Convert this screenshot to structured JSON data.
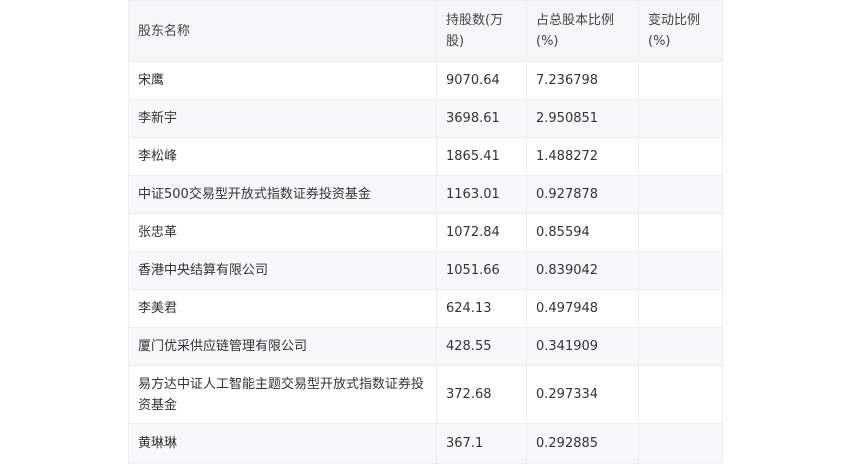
{
  "table": {
    "headers": [
      "股东名称",
      "持股数(万股)",
      "占总股本比例(%)",
      "变动比例(%)"
    ],
    "rows": [
      {
        "name": "宋鹰",
        "shares": "9070.64",
        "ratio": "7.236798",
        "change": ""
      },
      {
        "name": "李新宇",
        "shares": "3698.61",
        "ratio": "2.950851",
        "change": ""
      },
      {
        "name": "李松峰",
        "shares": "1865.41",
        "ratio": "1.488272",
        "change": ""
      },
      {
        "name": "中证500交易型开放式指数证券投资基金",
        "shares": "1163.01",
        "ratio": "0.927878",
        "change": ""
      },
      {
        "name": "张忠革",
        "shares": "1072.84",
        "ratio": "0.85594",
        "change": ""
      },
      {
        "name": "香港中央结算有限公司",
        "shares": "1051.66",
        "ratio": "0.839042",
        "change": ""
      },
      {
        "name": "李美君",
        "shares": "624.13",
        "ratio": "0.497948",
        "change": ""
      },
      {
        "name": "厦门优采供应链管理有限公司",
        "shares": "428.55",
        "ratio": "0.341909",
        "change": ""
      },
      {
        "name": "易方达中证人工智能主题交易型开放式指数证券投资基金",
        "shares": "372.68",
        "ratio": "0.297334",
        "change": ""
      },
      {
        "name": "黄琳琳",
        "shares": "367.1",
        "ratio": "0.292885",
        "change": ""
      }
    ]
  }
}
